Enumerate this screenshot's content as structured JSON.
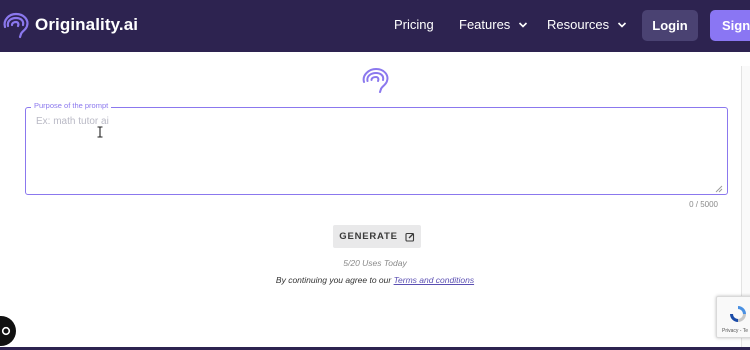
{
  "header": {
    "brand": "Originality.ai",
    "nav": [
      {
        "label": "Pricing",
        "dropdown": false
      },
      {
        "label": "Features",
        "dropdown": true
      },
      {
        "label": "Resources",
        "dropdown": true
      }
    ],
    "login_label": "Login",
    "signup_label": "Sign"
  },
  "main": {
    "prompt_legend": "Purpose of the prompt",
    "prompt_placeholder": "Ex: math tutor ai",
    "char_count": "0 / 5000",
    "generate_label": "GENERATE",
    "uses_today": "5/20 Uses Today",
    "agree_text": "By continuing you agree to our ",
    "terms_link": "Terms and conditions"
  },
  "recaptcha": {
    "text": "Privacy - Te"
  },
  "colors": {
    "navbar": "#2d2350",
    "accent": "#8b78ee",
    "login_bg": "#4a4272",
    "signup_bg": "#8a76f3"
  },
  "icons": {
    "logo": "brain-icon",
    "nav_dropdown": "chevron-down-icon",
    "generate": "edit-icon",
    "chat": "chat-bubble-icon",
    "recaptcha": "recaptcha-icon"
  }
}
